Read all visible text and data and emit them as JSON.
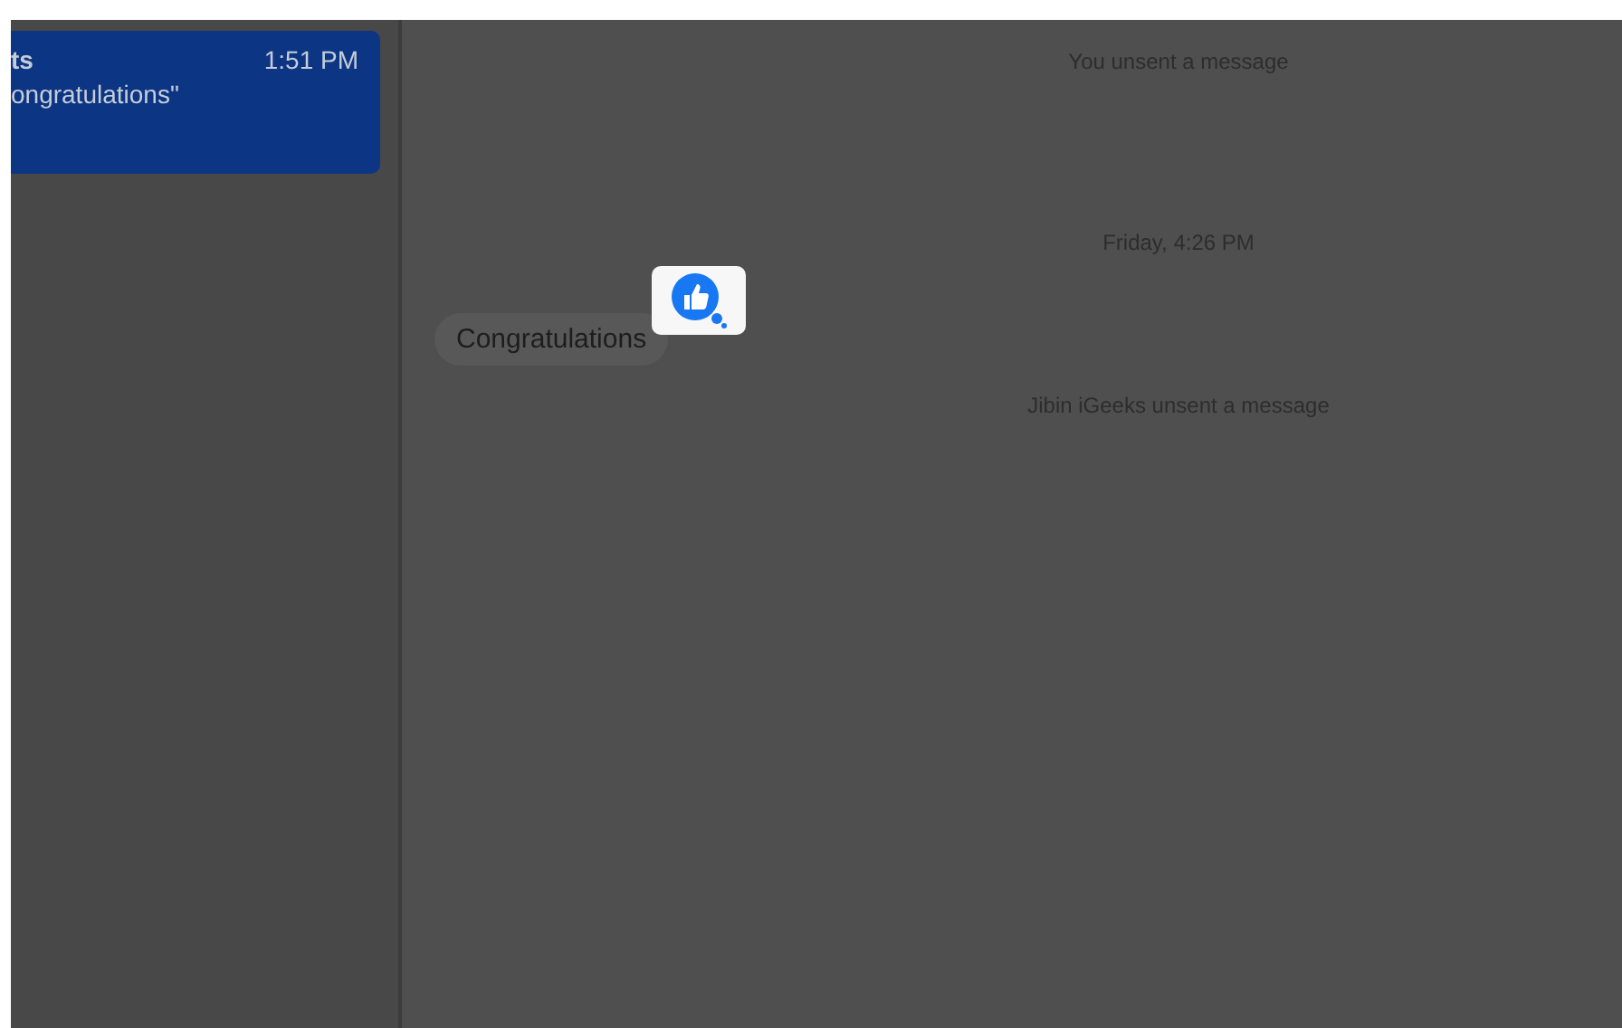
{
  "conversations": [
    {
      "name": "ts",
      "time": "1:51 PM",
      "preview": "ongratulations\"",
      "selected": true
    }
  ],
  "messages": [
    {
      "kind": "system",
      "text": "You unsent a message"
    },
    {
      "kind": "timestamp",
      "text": "Friday, 4:26 PM"
    },
    {
      "kind": "received",
      "text": "Congratulations",
      "tapback": true
    },
    {
      "kind": "system",
      "text": "Jibin iGeeks unsent a message"
    }
  ]
}
